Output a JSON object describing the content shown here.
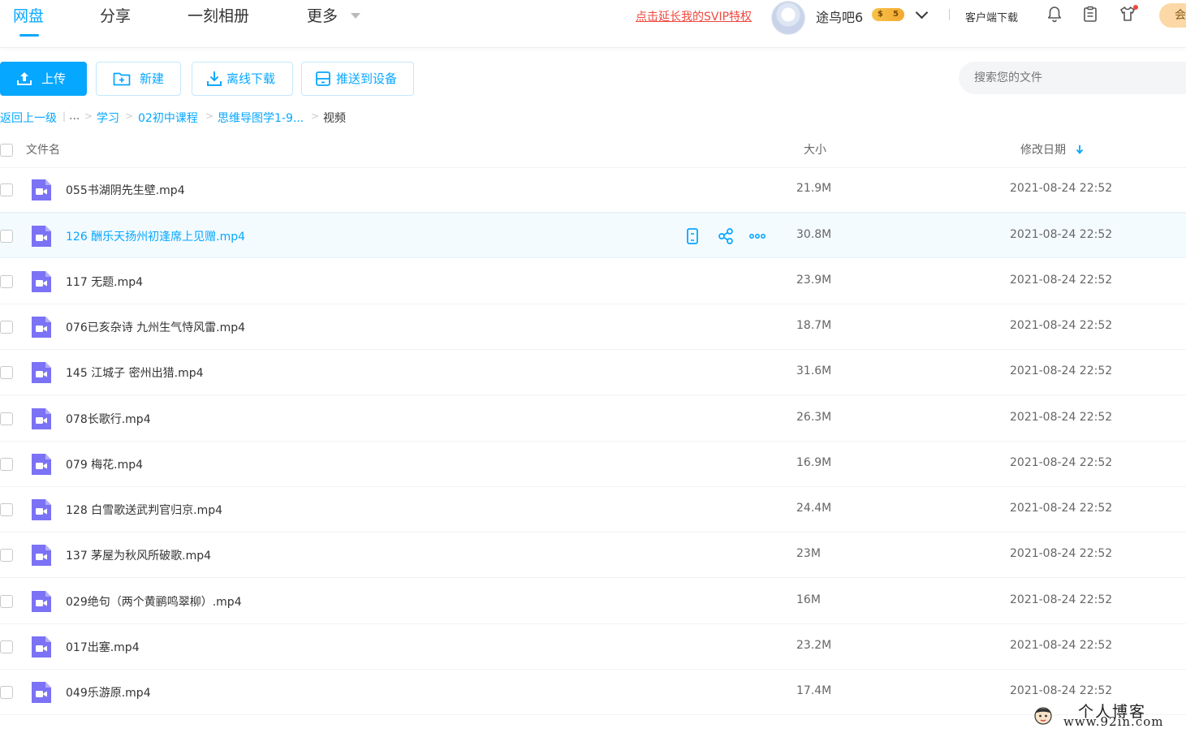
{
  "header": {
    "tabs": [
      {
        "label": "网盘",
        "active": true
      },
      {
        "label": "分享",
        "active": false
      },
      {
        "label": "一刻相册",
        "active": false
      },
      {
        "label": "更多",
        "active": false
      }
    ],
    "svip_link": "点击延长我的SVIP特权",
    "username": "途鸟吧6",
    "vip_badge": {
      "left": "$",
      "right": "5"
    },
    "client_download": "客户端下载",
    "vip_pill_label": "会",
    "icons": [
      "bell-icon",
      "clipboard-icon",
      "tshirt-icon"
    ],
    "accent_color": "#06a7ff",
    "warn_color": "#f0483e"
  },
  "toolbar": {
    "upload_label": "上传",
    "new_label": "新建",
    "offline_label": "离线下载",
    "push_label": "推送到设备",
    "search_placeholder": "搜索您的文件"
  },
  "breadcrumb": {
    "back": "返回上一级",
    "divider": "|",
    "ellipsis": "...",
    "items": [
      "学习",
      "02初中课程",
      "思维导图学1-9..."
    ],
    "current": "视频",
    "separator": ">"
  },
  "table": {
    "col_name": "文件名",
    "col_size": "大小",
    "col_date": "修改日期",
    "sort": "date-desc",
    "rows": [
      {
        "name": "055书湖阴先生壁.mp4",
        "size": "21.9M",
        "date": "2021-08-24 22:52"
      },
      {
        "name": "126 酬乐天扬州初逢席上见赠.mp4",
        "size": "30.8M",
        "date": "2021-08-24 22:52",
        "hovered": true
      },
      {
        "name": "117 无题.mp4",
        "size": "23.9M",
        "date": "2021-08-24 22:52"
      },
      {
        "name": "076已亥杂诗 九州生气恃风雷.mp4",
        "size": "18.7M",
        "date": "2021-08-24 22:52"
      },
      {
        "name": "145 江城子 密州出猎.mp4",
        "size": "31.6M",
        "date": "2021-08-24 22:52"
      },
      {
        "name": "078长歌行.mp4",
        "size": "26.3M",
        "date": "2021-08-24 22:52"
      },
      {
        "name": "079 梅花.mp4",
        "size": "16.9M",
        "date": "2021-08-24 22:52"
      },
      {
        "name": "128 白雪歌送武判官归京.mp4",
        "size": "24.4M",
        "date": "2021-08-24 22:52"
      },
      {
        "name": "137 茅屋为秋风所破歌.mp4",
        "size": "23M",
        "date": "2021-08-24 22:52"
      },
      {
        "name": "029绝句（两个黄鹂鸣翠柳）.mp4",
        "size": "16M",
        "date": "2021-08-24 22:52"
      },
      {
        "name": "017出塞.mp4",
        "size": "23.2M",
        "date": "2021-08-24 22:52"
      },
      {
        "name": "049乐游原.mp4",
        "size": "17.4M",
        "date": "2021-08-24 22:52"
      }
    ],
    "row_actions": [
      "phone-icon",
      "share-icon",
      "more-icon"
    ],
    "file_icon": "video-file-icon",
    "file_icon_color": "#7b72f5"
  },
  "watermark": {
    "line1": "个人博客",
    "line2": "www.92in.com"
  }
}
